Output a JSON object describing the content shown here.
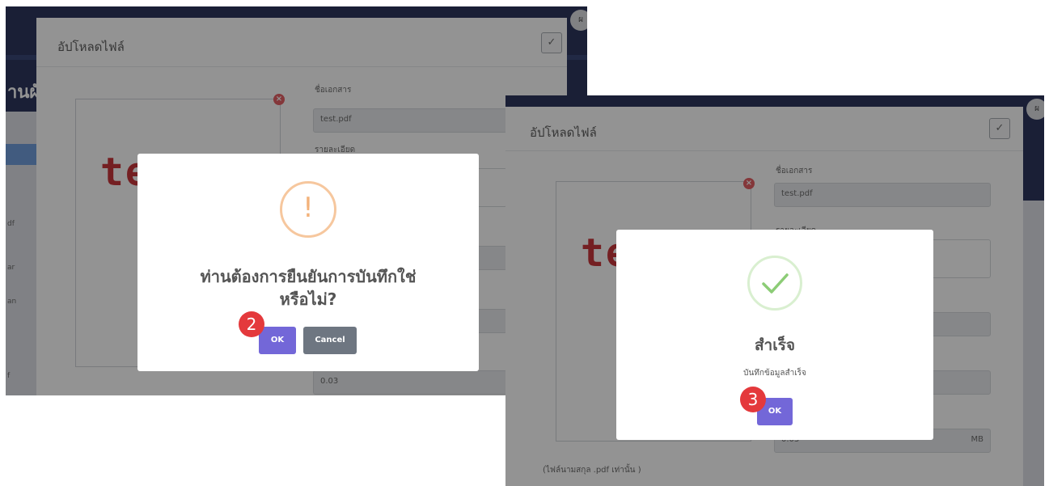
{
  "left": {
    "modal_title": "อัปโหลดไฟล์",
    "close_symbol": "✓",
    "bg_header_text": "านผั",
    "bg_side": [
      "df",
      "ar",
      "an",
      "f"
    ],
    "preview_text": "test",
    "remove_symbol": "×",
    "label_doc_name": "ชื่อเอกสาร",
    "doc_name_value": "test.pdf",
    "label_detail": "รายละเอียด",
    "size_value": "0.03",
    "dialog": {
      "icon": "!",
      "message_line1": "ท่านต้องการยืนยันการบันทึกใช่",
      "message_line2": "หรือไม่?",
      "ok_label": "OK",
      "cancel_label": "Cancel"
    },
    "step": "2"
  },
  "right": {
    "modal_title": "อัปโหลดไฟล์",
    "close_symbol": "✓",
    "preview_text": "te",
    "remove_symbol": "×",
    "label_doc_name": "ชื่อเอกสาร",
    "doc_name_value": "test.pdf",
    "label_detail": "รายละเอียด",
    "size_value": "0.03",
    "size_unit": "MB",
    "hint": "(ไฟล์นามสกุล .pdf เท่านั้น )",
    "dialog": {
      "title": "สำเร็จ",
      "message": "บันทึกข้อมูลสำเร็จ",
      "ok_label": "OK"
    },
    "step": "3"
  },
  "colors": {
    "ok_button": "#7367d8",
    "cancel_button": "#6e7681",
    "step_badge": "#e4393c",
    "warning": "#f3b27a",
    "success": "#8ccc76"
  },
  "icons": [
    "warning-icon",
    "success-check-icon",
    "close-icon",
    "remove-file-icon"
  ]
}
